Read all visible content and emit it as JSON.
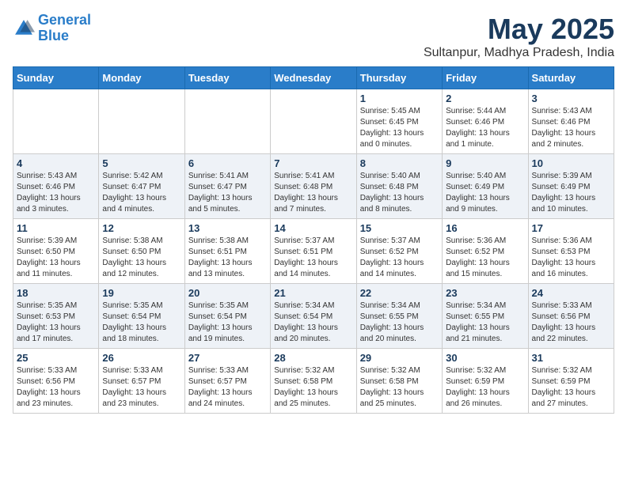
{
  "logo": {
    "line1": "General",
    "line2": "Blue"
  },
  "header": {
    "month": "May 2025",
    "location": "Sultanpur, Madhya Pradesh, India"
  },
  "weekdays": [
    "Sunday",
    "Monday",
    "Tuesday",
    "Wednesday",
    "Thursday",
    "Friday",
    "Saturday"
  ],
  "weeks": [
    [
      {
        "day": "",
        "info": ""
      },
      {
        "day": "",
        "info": ""
      },
      {
        "day": "",
        "info": ""
      },
      {
        "day": "",
        "info": ""
      },
      {
        "day": "1",
        "info": "Sunrise: 5:45 AM\nSunset: 6:45 PM\nDaylight: 13 hours\nand 0 minutes."
      },
      {
        "day": "2",
        "info": "Sunrise: 5:44 AM\nSunset: 6:46 PM\nDaylight: 13 hours\nand 1 minute."
      },
      {
        "day": "3",
        "info": "Sunrise: 5:43 AM\nSunset: 6:46 PM\nDaylight: 13 hours\nand 2 minutes."
      }
    ],
    [
      {
        "day": "4",
        "info": "Sunrise: 5:43 AM\nSunset: 6:46 PM\nDaylight: 13 hours\nand 3 minutes."
      },
      {
        "day": "5",
        "info": "Sunrise: 5:42 AM\nSunset: 6:47 PM\nDaylight: 13 hours\nand 4 minutes."
      },
      {
        "day": "6",
        "info": "Sunrise: 5:41 AM\nSunset: 6:47 PM\nDaylight: 13 hours\nand 5 minutes."
      },
      {
        "day": "7",
        "info": "Sunrise: 5:41 AM\nSunset: 6:48 PM\nDaylight: 13 hours\nand 7 minutes."
      },
      {
        "day": "8",
        "info": "Sunrise: 5:40 AM\nSunset: 6:48 PM\nDaylight: 13 hours\nand 8 minutes."
      },
      {
        "day": "9",
        "info": "Sunrise: 5:40 AM\nSunset: 6:49 PM\nDaylight: 13 hours\nand 9 minutes."
      },
      {
        "day": "10",
        "info": "Sunrise: 5:39 AM\nSunset: 6:49 PM\nDaylight: 13 hours\nand 10 minutes."
      }
    ],
    [
      {
        "day": "11",
        "info": "Sunrise: 5:39 AM\nSunset: 6:50 PM\nDaylight: 13 hours\nand 11 minutes."
      },
      {
        "day": "12",
        "info": "Sunrise: 5:38 AM\nSunset: 6:50 PM\nDaylight: 13 hours\nand 12 minutes."
      },
      {
        "day": "13",
        "info": "Sunrise: 5:38 AM\nSunset: 6:51 PM\nDaylight: 13 hours\nand 13 minutes."
      },
      {
        "day": "14",
        "info": "Sunrise: 5:37 AM\nSunset: 6:51 PM\nDaylight: 13 hours\nand 14 minutes."
      },
      {
        "day": "15",
        "info": "Sunrise: 5:37 AM\nSunset: 6:52 PM\nDaylight: 13 hours\nand 14 minutes."
      },
      {
        "day": "16",
        "info": "Sunrise: 5:36 AM\nSunset: 6:52 PM\nDaylight: 13 hours\nand 15 minutes."
      },
      {
        "day": "17",
        "info": "Sunrise: 5:36 AM\nSunset: 6:53 PM\nDaylight: 13 hours\nand 16 minutes."
      }
    ],
    [
      {
        "day": "18",
        "info": "Sunrise: 5:35 AM\nSunset: 6:53 PM\nDaylight: 13 hours\nand 17 minutes."
      },
      {
        "day": "19",
        "info": "Sunrise: 5:35 AM\nSunset: 6:54 PM\nDaylight: 13 hours\nand 18 minutes."
      },
      {
        "day": "20",
        "info": "Sunrise: 5:35 AM\nSunset: 6:54 PM\nDaylight: 13 hours\nand 19 minutes."
      },
      {
        "day": "21",
        "info": "Sunrise: 5:34 AM\nSunset: 6:54 PM\nDaylight: 13 hours\nand 20 minutes."
      },
      {
        "day": "22",
        "info": "Sunrise: 5:34 AM\nSunset: 6:55 PM\nDaylight: 13 hours\nand 20 minutes."
      },
      {
        "day": "23",
        "info": "Sunrise: 5:34 AM\nSunset: 6:55 PM\nDaylight: 13 hours\nand 21 minutes."
      },
      {
        "day": "24",
        "info": "Sunrise: 5:33 AM\nSunset: 6:56 PM\nDaylight: 13 hours\nand 22 minutes."
      }
    ],
    [
      {
        "day": "25",
        "info": "Sunrise: 5:33 AM\nSunset: 6:56 PM\nDaylight: 13 hours\nand 23 minutes."
      },
      {
        "day": "26",
        "info": "Sunrise: 5:33 AM\nSunset: 6:57 PM\nDaylight: 13 hours\nand 23 minutes."
      },
      {
        "day": "27",
        "info": "Sunrise: 5:33 AM\nSunset: 6:57 PM\nDaylight: 13 hours\nand 24 minutes."
      },
      {
        "day": "28",
        "info": "Sunrise: 5:32 AM\nSunset: 6:58 PM\nDaylight: 13 hours\nand 25 minutes."
      },
      {
        "day": "29",
        "info": "Sunrise: 5:32 AM\nSunset: 6:58 PM\nDaylight: 13 hours\nand 25 minutes."
      },
      {
        "day": "30",
        "info": "Sunrise: 5:32 AM\nSunset: 6:59 PM\nDaylight: 13 hours\nand 26 minutes."
      },
      {
        "day": "31",
        "info": "Sunrise: 5:32 AM\nSunset: 6:59 PM\nDaylight: 13 hours\nand 27 minutes."
      }
    ]
  ]
}
